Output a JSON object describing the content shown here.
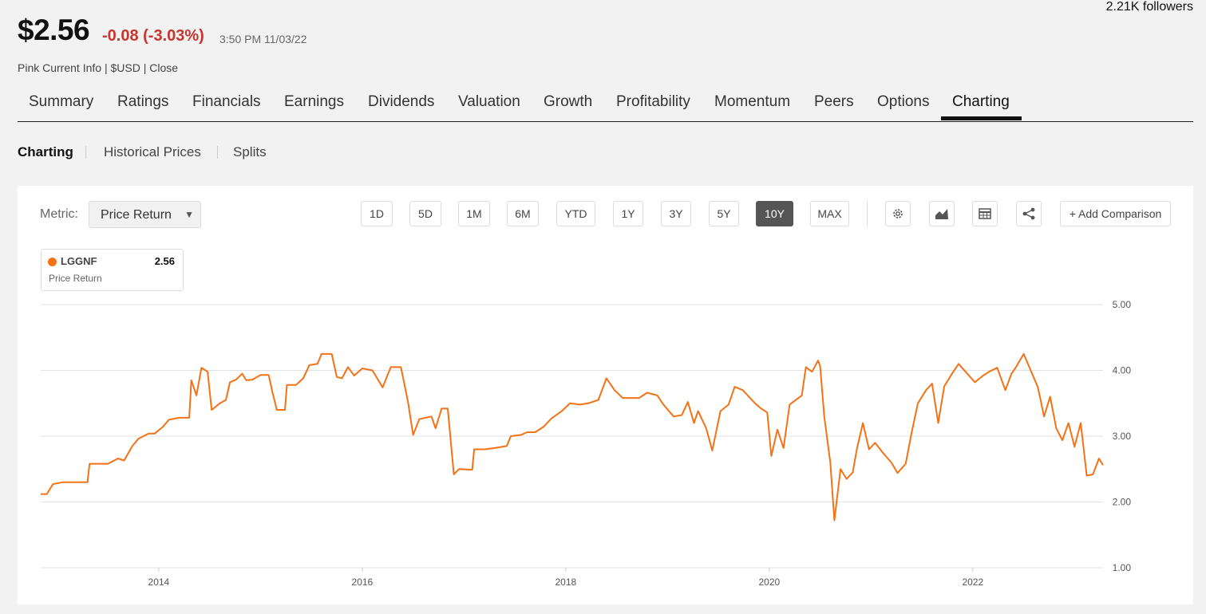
{
  "header": {
    "followers": "2.21K followers",
    "price": "$2.56",
    "change": "-0.08 (-3.03%)",
    "timestamp": "3:50 PM 11/03/22",
    "subinfo": "Pink Current Info | $USD | Close"
  },
  "tabs": [
    {
      "label": "Summary"
    },
    {
      "label": "Ratings"
    },
    {
      "label": "Financials"
    },
    {
      "label": "Earnings"
    },
    {
      "label": "Dividends"
    },
    {
      "label": "Valuation"
    },
    {
      "label": "Growth"
    },
    {
      "label": "Profitability"
    },
    {
      "label": "Momentum"
    },
    {
      "label": "Peers"
    },
    {
      "label": "Options"
    },
    {
      "label": "Charting"
    }
  ],
  "active_tab": "Charting",
  "subtabs": [
    {
      "label": "Charting"
    },
    {
      "label": "Historical Prices"
    },
    {
      "label": "Splits"
    }
  ],
  "toolbar": {
    "metric_label": "Metric:",
    "metric_value": "Price Return",
    "ranges": [
      "1D",
      "5D",
      "1M",
      "6M",
      "YTD",
      "1Y",
      "3Y",
      "5Y",
      "10Y",
      "MAX"
    ],
    "active_range": "10Y",
    "icons": [
      "gear-icon",
      "chart-type-icon",
      "table-icon",
      "share-icon"
    ],
    "add_comparison": "+ Add Comparison"
  },
  "legend": {
    "ticker": "LGGNF",
    "value": "2.56",
    "metric": "Price Return",
    "color": "#f47216"
  },
  "chart_data": {
    "type": "line",
    "ylim": [
      1,
      5
    ],
    "y_ticks": [
      "5.00",
      "4.00",
      "3.00",
      "2.00",
      "1.00"
    ],
    "x_ticks": [
      "2014",
      "2016",
      "2018",
      "2020",
      "2022"
    ],
    "grid": true,
    "series": [
      {
        "name": "LGGNF",
        "color": "#f47216",
        "points": [
          [
            2012.84,
            2.12
          ],
          [
            2012.9,
            2.12
          ],
          [
            2012.96,
            2.27
          ],
          [
            2013.05,
            2.3
          ],
          [
            2013.3,
            2.3
          ],
          [
            2013.32,
            2.58
          ],
          [
            2013.5,
            2.58
          ],
          [
            2013.6,
            2.66
          ],
          [
            2013.66,
            2.63
          ],
          [
            2013.74,
            2.85
          ],
          [
            2013.8,
            2.96
          ],
          [
            2013.9,
            3.04
          ],
          [
            2013.96,
            3.04
          ],
          [
            2014.04,
            3.14
          ],
          [
            2014.1,
            3.25
          ],
          [
            2014.2,
            3.28
          ],
          [
            2014.3,
            3.28
          ],
          [
            2014.32,
            3.85
          ],
          [
            2014.37,
            3.62
          ],
          [
            2014.42,
            4.04
          ],
          [
            2014.48,
            3.98
          ],
          [
            2014.52,
            3.4
          ],
          [
            2014.6,
            3.5
          ],
          [
            2014.66,
            3.55
          ],
          [
            2014.7,
            3.82
          ],
          [
            2014.76,
            3.86
          ],
          [
            2014.82,
            3.95
          ],
          [
            2014.86,
            3.85
          ],
          [
            2014.92,
            3.86
          ],
          [
            2015.0,
            3.93
          ],
          [
            2015.08,
            3.93
          ],
          [
            2015.12,
            3.65
          ],
          [
            2015.16,
            3.4
          ],
          [
            2015.24,
            3.4
          ],
          [
            2015.26,
            3.78
          ],
          [
            2015.35,
            3.78
          ],
          [
            2015.42,
            3.88
          ],
          [
            2015.48,
            4.08
          ],
          [
            2015.56,
            4.1
          ],
          [
            2015.6,
            4.25
          ],
          [
            2015.7,
            4.25
          ],
          [
            2015.75,
            3.9
          ],
          [
            2015.8,
            3.88
          ],
          [
            2015.86,
            4.05
          ],
          [
            2015.92,
            3.92
          ],
          [
            2016.0,
            4.03
          ],
          [
            2016.1,
            4.0
          ],
          [
            2016.2,
            3.74
          ],
          [
            2016.28,
            4.05
          ],
          [
            2016.38,
            4.05
          ],
          [
            2016.45,
            3.52
          ],
          [
            2016.5,
            3.02
          ],
          [
            2016.56,
            3.26
          ],
          [
            2016.68,
            3.3
          ],
          [
            2016.72,
            3.12
          ],
          [
            2016.78,
            3.42
          ],
          [
            2016.84,
            3.42
          ],
          [
            2016.9,
            2.42
          ],
          [
            2016.95,
            2.5
          ],
          [
            2017.08,
            2.49
          ],
          [
            2017.1,
            2.8
          ],
          [
            2017.2,
            2.8
          ],
          [
            2017.3,
            2.82
          ],
          [
            2017.42,
            2.85
          ],
          [
            2017.46,
            3.0
          ],
          [
            2017.56,
            3.02
          ],
          [
            2017.62,
            3.06
          ],
          [
            2017.7,
            3.06
          ],
          [
            2017.78,
            3.14
          ],
          [
            2017.86,
            3.27
          ],
          [
            2017.96,
            3.38
          ],
          [
            2018.04,
            3.5
          ],
          [
            2018.14,
            3.48
          ],
          [
            2018.22,
            3.5
          ],
          [
            2018.32,
            3.55
          ],
          [
            2018.4,
            3.88
          ],
          [
            2018.48,
            3.7
          ],
          [
            2018.56,
            3.58
          ],
          [
            2018.72,
            3.58
          ],
          [
            2018.8,
            3.66
          ],
          [
            2018.9,
            3.62
          ],
          [
            2018.96,
            3.48
          ],
          [
            2019.06,
            3.3
          ],
          [
            2019.14,
            3.32
          ],
          [
            2019.2,
            3.52
          ],
          [
            2019.26,
            3.2
          ],
          [
            2019.3,
            3.38
          ],
          [
            2019.38,
            3.12
          ],
          [
            2019.44,
            2.78
          ],
          [
            2019.52,
            3.38
          ],
          [
            2019.6,
            3.48
          ],
          [
            2019.66,
            3.75
          ],
          [
            2019.74,
            3.7
          ],
          [
            2019.8,
            3.6
          ],
          [
            2019.86,
            3.5
          ],
          [
            2019.92,
            3.42
          ],
          [
            2019.98,
            3.36
          ],
          [
            2020.02,
            2.7
          ],
          [
            2020.08,
            3.1
          ],
          [
            2020.14,
            2.82
          ],
          [
            2020.2,
            3.48
          ],
          [
            2020.26,
            3.55
          ],
          [
            2020.32,
            3.62
          ],
          [
            2020.36,
            4.05
          ],
          [
            2020.42,
            3.98
          ],
          [
            2020.48,
            4.15
          ],
          [
            2020.5,
            4.06
          ],
          [
            2020.54,
            3.3
          ],
          [
            2020.6,
            2.6
          ],
          [
            2020.64,
            1.72
          ],
          [
            2020.7,
            2.5
          ],
          [
            2020.76,
            2.35
          ],
          [
            2020.82,
            2.45
          ],
          [
            2020.86,
            2.8
          ],
          [
            2020.92,
            3.2
          ],
          [
            2020.98,
            2.8
          ],
          [
            2021.04,
            2.9
          ],
          [
            2021.12,
            2.74
          ],
          [
            2021.2,
            2.6
          ],
          [
            2021.26,
            2.44
          ],
          [
            2021.34,
            2.58
          ],
          [
            2021.4,
            3.06
          ],
          [
            2021.46,
            3.5
          ],
          [
            2021.54,
            3.7
          ],
          [
            2021.6,
            3.8
          ],
          [
            2021.66,
            3.2
          ],
          [
            2021.72,
            3.76
          ],
          [
            2021.8,
            3.96
          ],
          [
            2021.86,
            4.1
          ],
          [
            2021.94,
            3.96
          ],
          [
            2022.02,
            3.82
          ],
          [
            2022.1,
            3.92
          ],
          [
            2022.16,
            3.98
          ],
          [
            2022.24,
            4.04
          ],
          [
            2022.32,
            3.7
          ],
          [
            2022.38,
            3.95
          ],
          [
            2022.42,
            4.04
          ],
          [
            2022.5,
            4.25
          ],
          [
            2022.58,
            3.96
          ],
          [
            2022.64,
            3.74
          ],
          [
            2022.7,
            3.3
          ],
          [
            2022.76,
            3.6
          ],
          [
            2022.82,
            3.12
          ],
          [
            2022.88,
            2.94
          ],
          [
            2022.94,
            3.2
          ],
          [
            2023.0,
            2.84
          ],
          [
            2023.06,
            3.2
          ],
          [
            2023.12,
            2.4
          ],
          [
            2023.18,
            2.42
          ],
          [
            2023.24,
            2.66
          ],
          [
            2023.28,
            2.56
          ]
        ]
      }
    ]
  }
}
